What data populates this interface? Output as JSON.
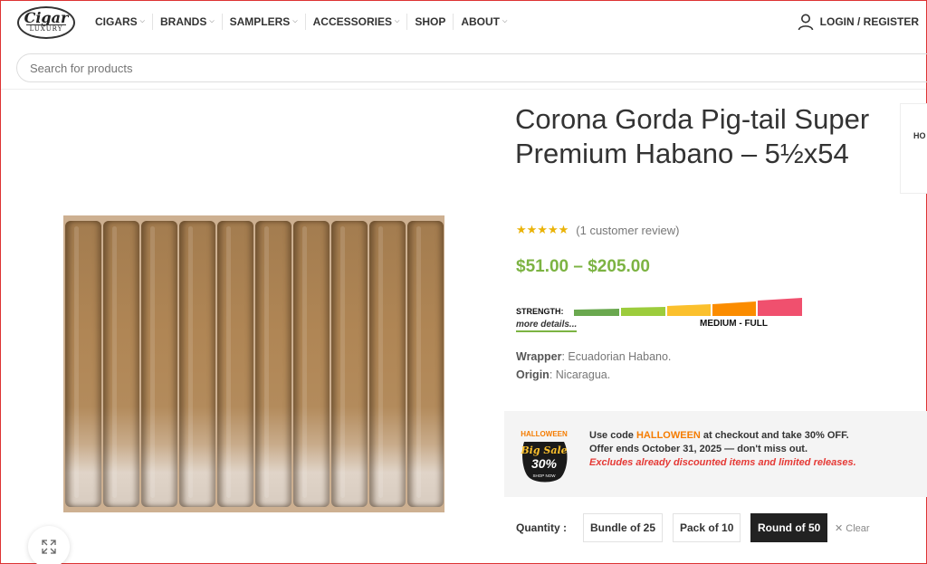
{
  "header": {
    "logo_top": "Cigar",
    "logo_bottom": "LUXURY",
    "nav": [
      {
        "label": "CIGARS",
        "has_dropdown": true
      },
      {
        "label": "BRANDS",
        "has_dropdown": true
      },
      {
        "label": "SAMPLERS",
        "has_dropdown": true
      },
      {
        "label": "ACCESSORIES",
        "has_dropdown": true
      },
      {
        "label": "SHOP",
        "has_dropdown": false
      },
      {
        "label": "ABOUT",
        "has_dropdown": true
      }
    ],
    "account_label": "LOGIN / REGISTER",
    "account_icon": "user-icon"
  },
  "search": {
    "placeholder": "Search for products"
  },
  "product": {
    "title": "Corona Gorda Pig-tail Super Premium Habano – 5½x54",
    "rating_stars": "★★★★★",
    "rating": 5,
    "review_text": "(1 customer review)",
    "price": "$51.00 – $205.00",
    "strength": {
      "label": "STRENGTH:",
      "more": "more details...",
      "value": "MEDIUM - FULL",
      "segments": [
        "#6aa84f",
        "#9ccc3c",
        "#fbc02d",
        "#fb8c00",
        "#f0506e"
      ]
    },
    "wrapper_label": "Wrapper",
    "wrapper_value": ": Ecuadorian Habano.",
    "origin_label": "Origin",
    "origin_value": ": Nicaragua."
  },
  "promo": {
    "badge_line1": "HALLOWEEN",
    "badge_line2": "Big Sale",
    "badge_line3": "30%",
    "badge_line4": "SHOP NOW",
    "line1_pre": "Use code ",
    "code": "HALLOWEEN",
    "line1_post": " at checkout and take 30% OFF.",
    "line2": "Offer ends October 31, 2025 — don't miss out.",
    "line3": "Excludes already discounted items and limited releases."
  },
  "quantity": {
    "label": "Quantity :",
    "options": [
      "Bundle of 25",
      "Pack of 10",
      "Round of 50"
    ],
    "selected": "Round of 50",
    "clear": "Clear"
  },
  "side_card_text": "HO"
}
